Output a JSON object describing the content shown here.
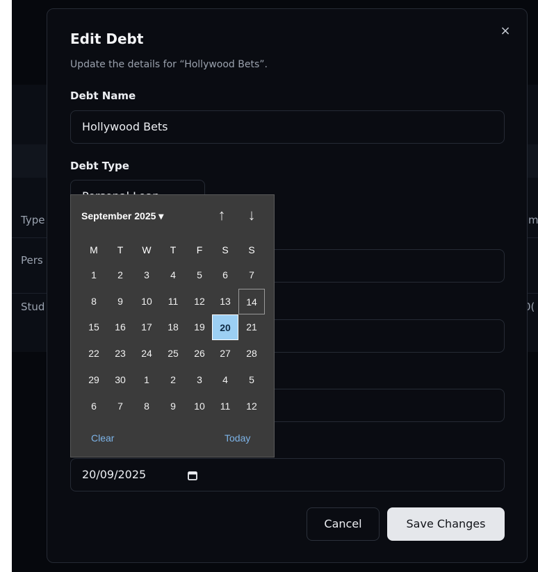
{
  "background": {
    "left_col": [
      "Type",
      "Pers",
      "Stud"
    ],
    "right_col": [
      "m",
      "",
      "0("
    ]
  },
  "dialog": {
    "title": "Edit Debt",
    "subtitle": "Update the details for “Hollywood Bets”.",
    "close_icon": "×",
    "name_label": "Debt Name",
    "name_value": "Hollywood Bets",
    "type_label": "Debt Type",
    "type_value": "Personal Loan",
    "date_value": "20/09/2025",
    "cancel_label": "Cancel",
    "save_label": "Save Changes"
  },
  "datepicker": {
    "month_label": "September 2025 ▾",
    "prev_icon": "↑",
    "next_icon": "↓",
    "weekdays": [
      "M",
      "T",
      "W",
      "T",
      "F",
      "S",
      "S"
    ],
    "weeks": [
      [
        "1",
        "2",
        "3",
        "4",
        "5",
        "6",
        "7"
      ],
      [
        "8",
        "9",
        "10",
        "11",
        "12",
        "13",
        "14"
      ],
      [
        "15",
        "16",
        "17",
        "18",
        "19",
        "20",
        "21"
      ],
      [
        "22",
        "23",
        "24",
        "25",
        "26",
        "27",
        "28"
      ],
      [
        "29",
        "30",
        "1",
        "2",
        "3",
        "4",
        "5"
      ],
      [
        "6",
        "7",
        "8",
        "9",
        "10",
        "11",
        "12"
      ]
    ],
    "today_day": "14",
    "selected_day": "20",
    "clear_label": "Clear",
    "today_label": "Today"
  },
  "colors": {
    "accent_link": "#7db4e8",
    "selected_day_bg": "#9ccff3",
    "save_button_bg": "#e5e7eb"
  },
  "icons": {
    "calendar": "calendar-icon",
    "close": "close-icon"
  }
}
